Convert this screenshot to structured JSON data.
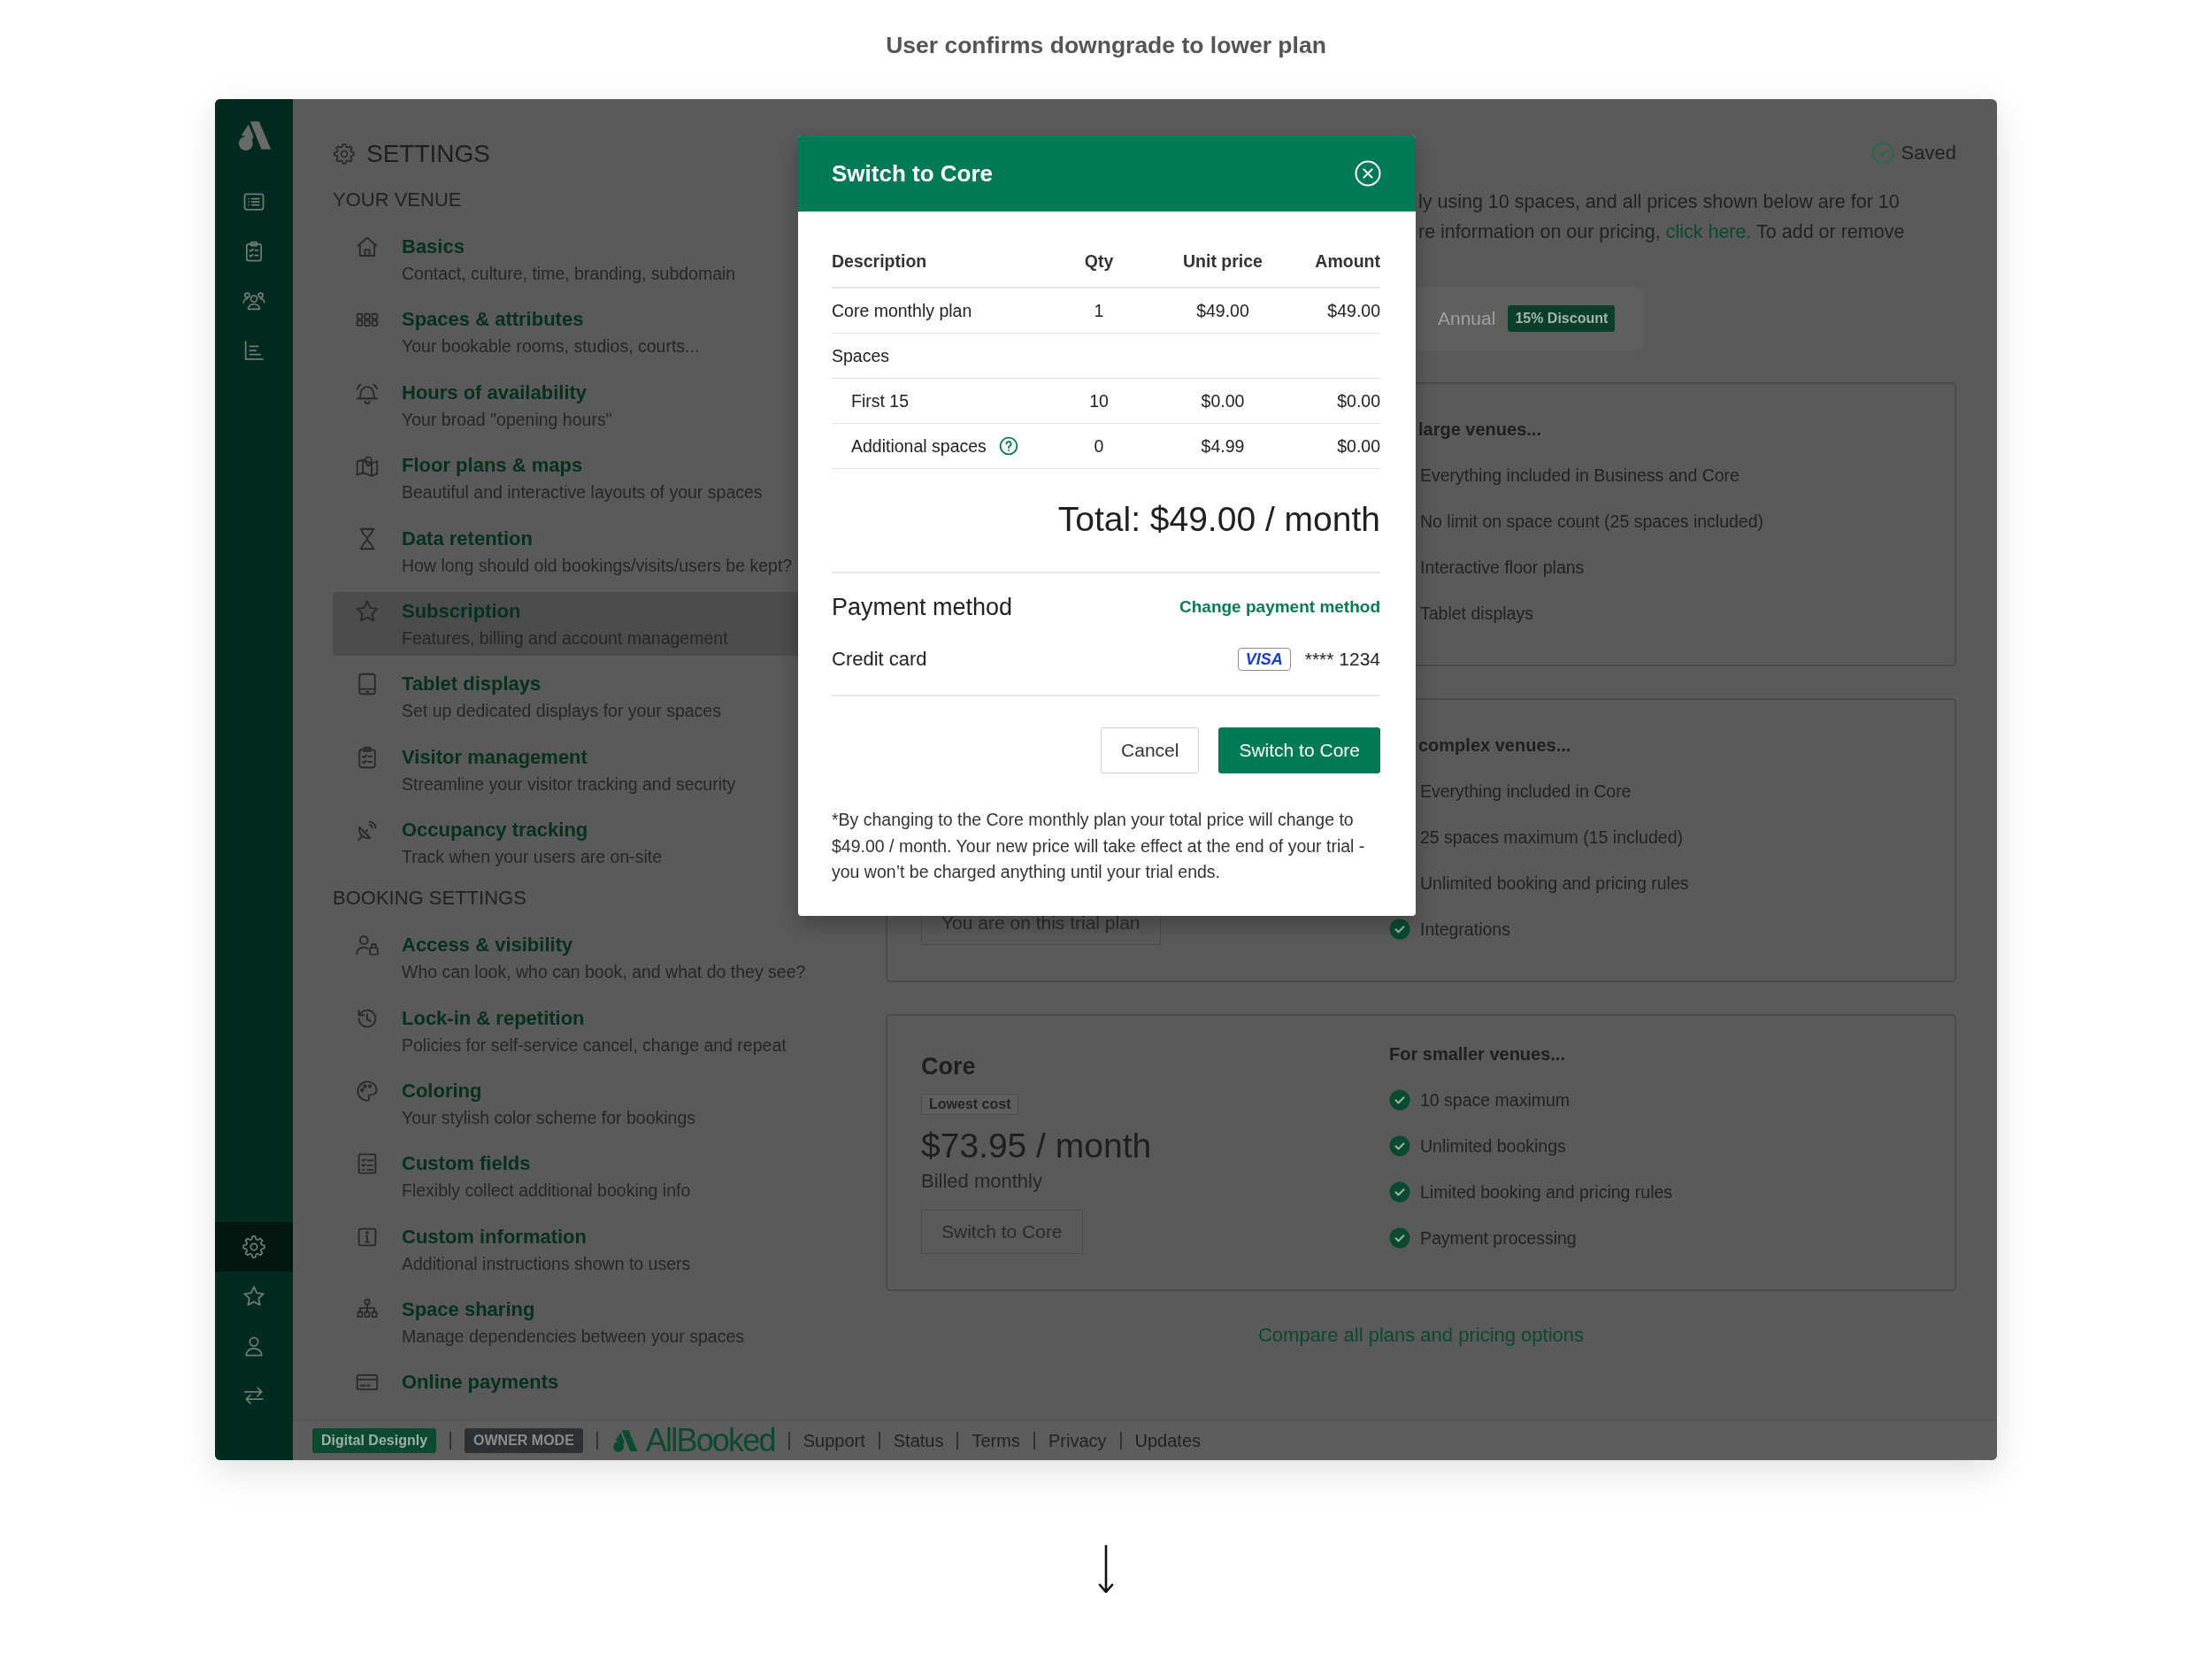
{
  "caption": "User confirms downgrade to lower plan",
  "sidebar": {
    "top_items": [
      {
        "selected": false
      },
      {
        "selected": false
      },
      {
        "selected": false
      },
      {
        "selected": false
      }
    ],
    "bottom_items": [
      {
        "selected": true
      },
      {
        "selected": false
      },
      {
        "selected": false
      },
      {
        "selected": false
      }
    ]
  },
  "settings": {
    "title": "SETTINGS",
    "sections": [
      {
        "heading": "YOUR VENUE",
        "items": [
          {
            "title": "Basics",
            "subtitle": "Contact, culture, time, branding, subdomain",
            "selected": false
          },
          {
            "title": "Spaces & attributes",
            "subtitle": "Your bookable rooms, studios, courts...",
            "selected": false
          },
          {
            "title": "Hours of availability",
            "subtitle": "Your broad \"opening hours\"",
            "selected": false
          },
          {
            "title": "Floor plans & maps",
            "subtitle": "Beautiful and interactive layouts of your spaces",
            "selected": false
          },
          {
            "title": "Data retention",
            "subtitle": "How long should old bookings/visits/users be kept?",
            "selected": false
          },
          {
            "title": "Subscription",
            "subtitle": "Features, billing and account management",
            "selected": true
          },
          {
            "title": "Tablet displays",
            "subtitle": "Set up dedicated displays for your spaces",
            "selected": false
          },
          {
            "title": "Visitor management",
            "subtitle": "Streamline your visitor tracking and security",
            "selected": false
          },
          {
            "title": "Occupancy tracking",
            "subtitle": "Track when your users are on-site",
            "selected": false
          }
        ]
      },
      {
        "heading": "BOOKING SETTINGS",
        "items": [
          {
            "title": "Access & visibility",
            "subtitle": "Who can look, who can book, and what do they see?",
            "selected": false
          },
          {
            "title": "Lock-in & repetition",
            "subtitle": "Policies for self-service cancel, change and repeat",
            "selected": false
          },
          {
            "title": "Coloring",
            "subtitle": "Your stylish color scheme for bookings",
            "selected": false
          },
          {
            "title": "Custom fields",
            "subtitle": "Flexibly collect additional booking info",
            "selected": false
          },
          {
            "title": "Custom information",
            "subtitle": "Additional instructions shown to users",
            "selected": false
          },
          {
            "title": "Space sharing",
            "subtitle": "Manage dependencies between your spaces",
            "selected": false
          },
          {
            "title": "Online payments",
            "selected": false
          }
        ]
      }
    ]
  },
  "main": {
    "saved": "Saved",
    "intro": {
      "lines": [
        {
          "text": "ly using 10 spaces, and all prices shown below are for 10"
        },
        {
          "text": "re information on our pricing,",
          "link": "click here.",
          "after": "To add or remove"
        }
      ]
    },
    "billing_toggle": {
      "options": [
        {
          "label": "Annual",
          "badge": "15% Discount",
          "selected": false
        }
      ]
    },
    "plans": [
      {
        "features_heading": "large venues...",
        "features": [
          "Everything included in Business and Core",
          "No limit on space count (25 spaces included)",
          "Interactive floor plans",
          "Tablet displays"
        ]
      },
      {
        "button": "You are on this trial plan",
        "features_heading": "complex venues...",
        "features": [
          "Everything included in Core",
          "25 spaces maximum (15 included)",
          "Unlimited booking and pricing rules",
          "Integrations"
        ]
      },
      {
        "name": "Core",
        "tag": "Lowest cost",
        "price": "$73.95 / month",
        "billing": "Billed monthly",
        "button": "Switch to Core",
        "features_heading": "For smaller venues...",
        "features": [
          "10 space maximum",
          "Unlimited bookings",
          "Limited booking and pricing rules",
          "Payment processing"
        ]
      }
    ],
    "compare_link": "Compare all plans and pricing options"
  },
  "footer": {
    "workspace": "Digital Designly",
    "mode": "OWNER MODE",
    "brand": "AllBooked",
    "links": [
      "Support",
      "Status",
      "Terms",
      "Privacy",
      "Updates"
    ]
  },
  "modal": {
    "title": "Switch to Core",
    "table": {
      "columns": [
        "Description",
        "Qty",
        "Unit price",
        "Amount"
      ],
      "rows": [
        {
          "kind": "item",
          "cells": [
            "Core monthly plan",
            "1",
            "$49.00",
            "$49.00"
          ]
        },
        {
          "kind": "group",
          "cells": [
            "Spaces"
          ]
        },
        {
          "kind": "subitem",
          "cells": [
            "First 15",
            "10",
            "$0.00",
            "$0.00"
          ]
        },
        {
          "kind": "subitem",
          "help": true,
          "cells": [
            "Additional spaces",
            "0",
            "$4.99",
            "$0.00"
          ]
        }
      ]
    },
    "total": "Total: $49.00 / month",
    "payment": {
      "heading": "Payment method",
      "change_link": "Change payment method",
      "method": "Credit card",
      "card_brand": "VISA",
      "card_number": "**** 1234"
    },
    "buttons": [
      {
        "kind": "secondary",
        "label": "Cancel"
      },
      {
        "kind": "primary",
        "label": "Switch to Core"
      }
    ],
    "note": "*By changing to the Core monthly plan your total price will change to $49.00 / month. Your new price will take effect at the end of your trial - you won’t be charged anything until your trial ends."
  }
}
